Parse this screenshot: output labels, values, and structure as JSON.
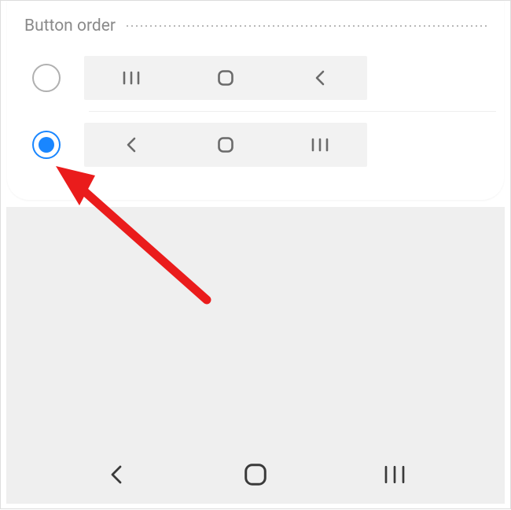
{
  "section": {
    "title": "Button order"
  },
  "options": [
    {
      "selected": false,
      "layout": [
        "recent",
        "home",
        "back"
      ]
    },
    {
      "selected": true,
      "layout": [
        "back",
        "home",
        "recent"
      ]
    }
  ],
  "system_nav": {
    "layout": [
      "back",
      "home",
      "recent"
    ]
  },
  "icons": {
    "recent": "recent-apps-icon",
    "home": "home-icon",
    "back": "back-icon"
  },
  "colors": {
    "accent": "#1986ff",
    "muted": "#8a8a8a",
    "preview_bg": "#f2f2f2"
  },
  "annotation": {
    "type": "arrow",
    "target": "radio-option-2"
  }
}
